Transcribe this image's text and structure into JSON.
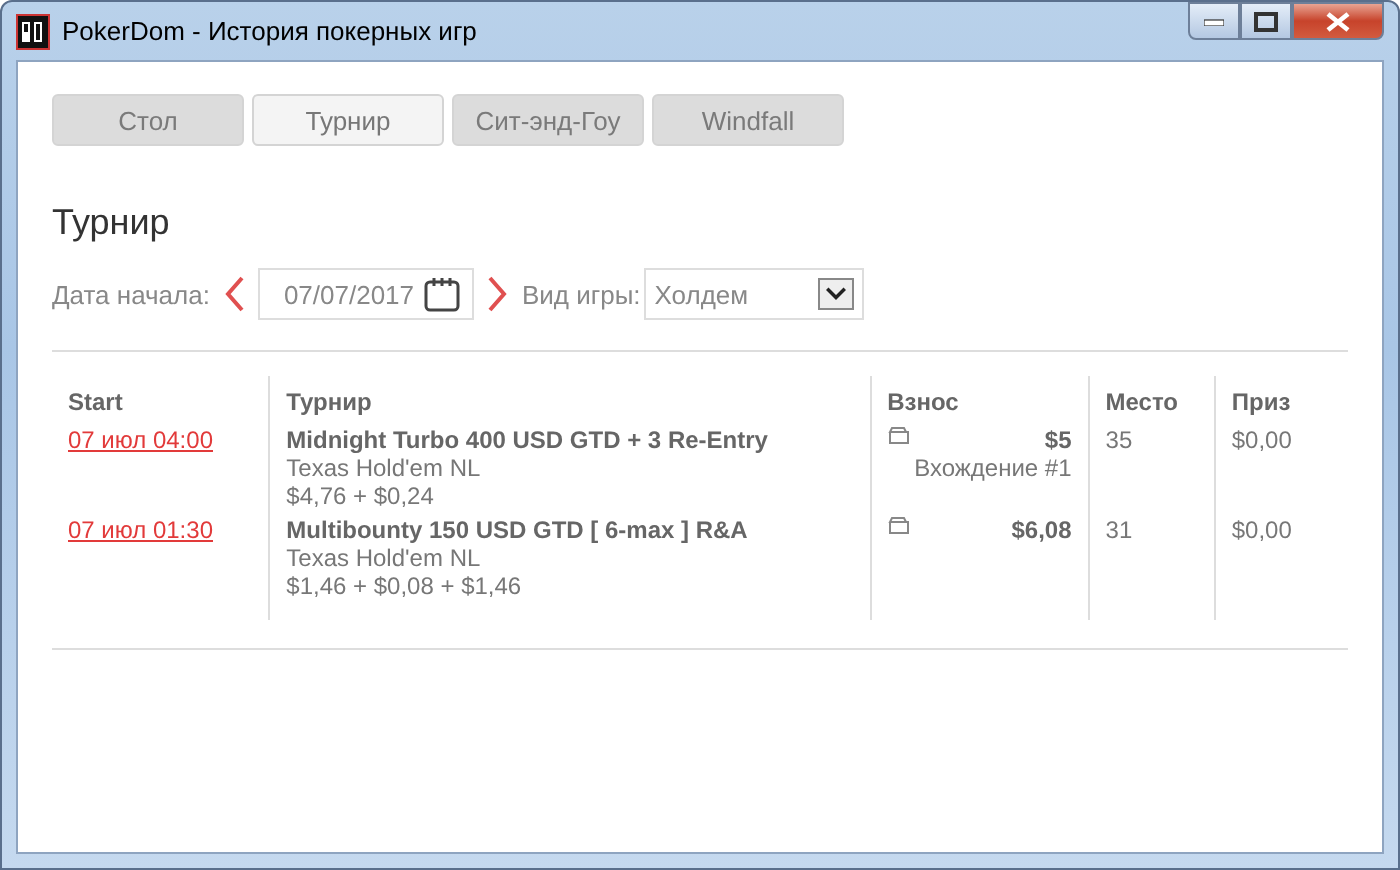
{
  "window": {
    "title": "PokerDom - История покерных игр"
  },
  "tabs": [
    {
      "label": "Стол",
      "selected": false
    },
    {
      "label": "Турнир",
      "selected": true
    },
    {
      "label": "Сит-энд-Гоу",
      "selected": false
    },
    {
      "label": "Windfall",
      "selected": false
    }
  ],
  "heading": "Турнир",
  "filters": {
    "date_label": "Дата начала:",
    "date_value": "07/07/2017",
    "game_label": "Вид игры:",
    "game_value": "Холдем"
  },
  "table": {
    "columns": [
      "Start",
      "Турнир",
      "Взнос",
      "Место",
      "Приз"
    ],
    "rows": [
      {
        "start": "07 июл 04:00",
        "name": "Midnight Turbo 400 USD GTD + 3 Re-Entry",
        "game": "Texas Hold'em NL",
        "fees": "$4,76 + $0,24",
        "buyin": "$5",
        "entry": "Вхождение #1",
        "place": "35",
        "prize": "$0,00"
      },
      {
        "start": "07 июл 01:30",
        "name": "Multibounty 150 USD GTD [ 6-max ] R&A",
        "game": "Texas Hold'em NL",
        "fees": "$1,46 + $0,08 + $1,46",
        "buyin": "$6,08",
        "place": "31",
        "prize": "$0,00"
      }
    ]
  }
}
